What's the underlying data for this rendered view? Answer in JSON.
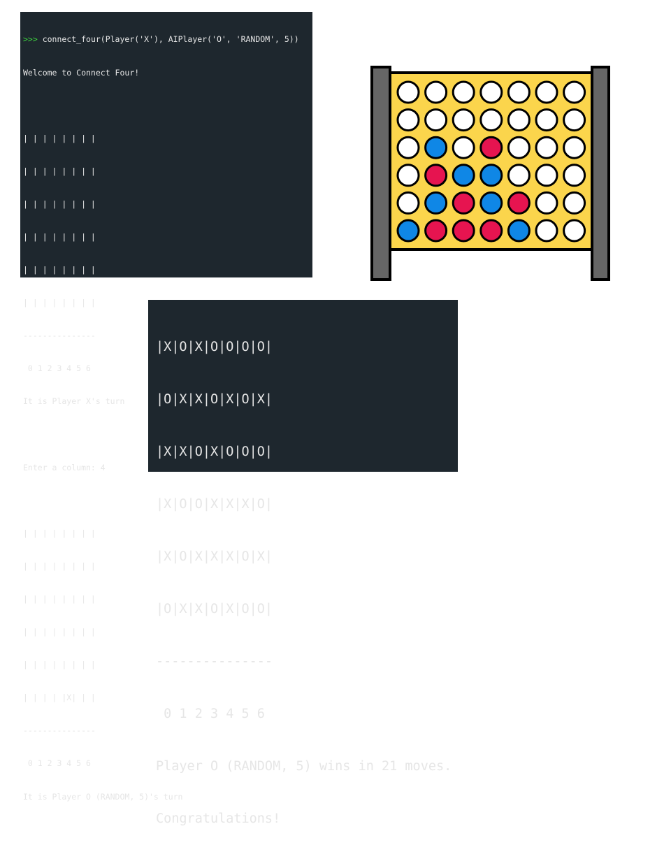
{
  "top_terminal": {
    "prompt": ">>>",
    "command": " connect_four(Player('X'), AIPlayer('O', 'RANDOM', 5))",
    "lines": [
      "Welcome to Connect Four!",
      "",
      "| | | | | | | |",
      "| | | | | | | |",
      "| | | | | | | |",
      "| | | | | | | |",
      "| | | | | | | |",
      "| | | | | | | |",
      "---------------",
      " 0 1 2 3 4 5 6",
      "It is Player X's turn",
      "",
      "Enter a column: 4",
      "",
      "| | | | | | | |",
      "| | | | | | | |",
      "| | | | | | | |",
      "| | | | | | | |",
      "| | | | | | | |",
      "| | | | |X| | |",
      "---------------",
      " 0 1 2 3 4 5 6",
      "It is Player O (RANDOM, 5)'s turn"
    ]
  },
  "board_graphic": {
    "grid": [
      [
        "empty",
        "empty",
        "empty",
        "empty",
        "empty",
        "empty",
        "empty"
      ],
      [
        "empty",
        "empty",
        "empty",
        "empty",
        "empty",
        "empty",
        "empty"
      ],
      [
        "empty",
        "blue",
        "empty",
        "red",
        "empty",
        "empty",
        "empty"
      ],
      [
        "empty",
        "red",
        "blue",
        "blue",
        "empty",
        "empty",
        "empty"
      ],
      [
        "empty",
        "blue",
        "red",
        "blue",
        "red",
        "empty",
        "empty"
      ],
      [
        "blue",
        "red",
        "red",
        "red",
        "blue",
        "empty",
        "empty"
      ]
    ],
    "colors": {
      "frame": "#fbd54c",
      "post": "#666666",
      "outline": "#000000",
      "blue": "#0f87e6",
      "red": "#e61450",
      "empty": "#ffffff"
    }
  },
  "bottom_terminal": {
    "lines": [
      "|X|O|X|O|O|O|O|",
      "|O|X|X|O|X|O|X|",
      "|X|X|O|X|O|O|O|",
      "|X|O|O|X|X|X|O|",
      "|X|O|X|X|X|O|X|",
      "|O|X|X|O|X|O|O|",
      "---------------",
      " 0 1 2 3 4 5 6",
      "Player O (RANDOM, 5) wins in 21 moves.",
      "Congratulations!"
    ]
  }
}
